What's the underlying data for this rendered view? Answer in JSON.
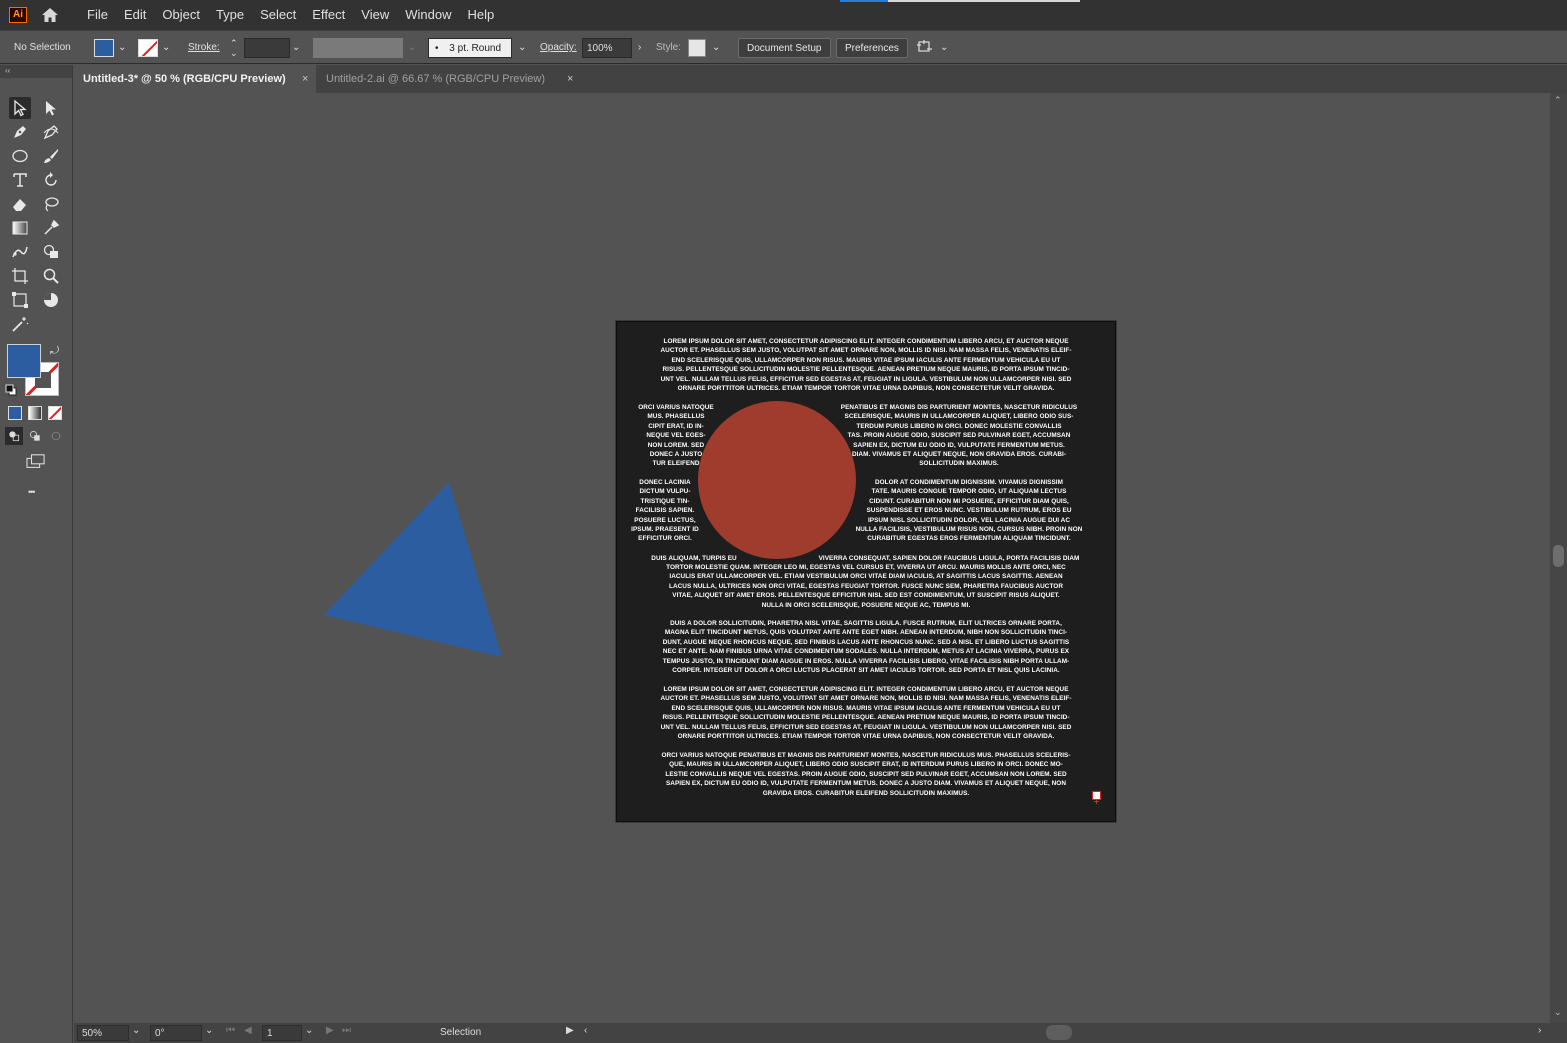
{
  "app": {
    "logo": "Ai"
  },
  "menu": [
    "File",
    "Edit",
    "Object",
    "Type",
    "Select",
    "Effect",
    "View",
    "Window",
    "Help"
  ],
  "control_bar": {
    "selection_status": "No Selection",
    "stroke_label": "Stroke:",
    "brush_value": "3 pt. Round",
    "brush_bullet": "•",
    "opacity_label": "Opacity:",
    "opacity_value": "100%",
    "style_label": "Style:",
    "document_setup": "Document Setup",
    "preferences": "Preferences"
  },
  "tabs": [
    {
      "label": "Untitled-3* @ 50 % (RGB/CPU Preview)",
      "close": "×"
    },
    {
      "label": "Untitled-2.ai @ 66.67 % (RGB/CPU Preview)",
      "close": "×"
    }
  ],
  "toolbar": {
    "collapse": "‹‹",
    "more": "•••"
  },
  "colors": {
    "fill": "#2d5da1",
    "circle": "#a03c2e",
    "triangle": "#2d5da1",
    "artboard": "#1e1e1e",
    "ui_bg": "#535353"
  },
  "artboard_text": {
    "p1": "LOREM IPSUM DOLOR SIT AMET, CONSECTETUR ADIPISCING ELIT. INTEGER CONDIMENTUM LIBERO ARCU, ET AUCTOR NEQUE\nAUCTOR ET. PHASELLUS SEM JUSTO, VOLUTPAT SIT AMET ORNARE NON, MOLLIS ID NISI. NAM MASSA FELIS, VENENATIS ELEIF-\nEND SCELERISQUE QUIS, ULLAMCORPER NON RISUS. MAURIS VITAE IPSUM IACULIS ANTE FERMENTUM VEHICULA EU UT\nRISUS. PELLENTESQUE SOLLICITUDIN MOLESTIE PELLENTESQUE. AENEAN PRETIUM NEQUE MAURIS, ID PORTA IPSUM TINCID-\nUNT VEL. NULLAM TELLUS FELIS, EFFICITUR SED EGESTAS AT, FEUGIAT IN LIGULA. VESTIBULUM NON ULLAMCORPER NISI. SED\nORNARE PORTTITOR ULTRICES. ETIAM TEMPOR TORTOR VITAE URNA DAPIBUS, NON CONSECTETUR VELIT GRAVIDA.",
    "p2_left": "ORCI VARIUS NATOQUE\nMUS. PHASELLUS\nCIPIT ERAT, ID IN-\nNEQUE VEL EGES-\nNON LOREM. SED\nDONEC A JUSTO\nTUR ELEIFEND",
    "p2_right": "PENATIBUS ET MAGNIS DIS PARTURIENT MONTES, NASCETUR RIDICULUS\nSCELERISQUE, MAURIS IN ULLAMCORPER ALIQUET, LIBERO ODIO SUS-\nTERDUM PURUS LIBERO IN ORCI. DONEC MOLESTIE CONVALLIS\nTAS. PROIN AUGUE ODIO, SUSCIPIT SED PULVINAR EGET, ACCUMSAN\nSAPIEN EX, DICTUM EU ODIO ID, VULPUTATE FERMENTUM METUS.\nDIAM. VIVAMUS ET ALIQUET NEQUE, NON GRAVIDA EROS. CURABI-\nSOLLICITUDIN MAXIMUS.",
    "p3_left": "DONEC LACINIA\nDICTUM VULPU-\nTRISTIQUE TIN-\nFACILISIS SAPIEN.\nPOSUERE LUCTUS,\nIPSUM. PRAESENT ID\nEFFICITUR ORCI.",
    "p3_right": "DOLOR AT CONDIMENTUM DIGNISSIM. VIVAMUS DIGNISSIM\nTATE. MAURIS CONGUE TEMPOR ODIO, UT ALIQUAM LECTUS\nCIDUNT. CURABITUR NON MI POSUERE, EFFICITUR DIAM QUIS,\nSUSPENDISSE ET EROS NUNC. VESTIBULUM RUTRUM, EROS EU\nIPSUM NISL SOLLICITUDIN DOLOR, VEL LACINIA AUGUE DUI AC\nNULLA FACILISIS, VESTIBULUM RISUS NON, CURSUS NIBH. PROIN NON\nCURABITUR EGESTAS EROS FERMENTUM ALIQUAM TINCIDUNT.",
    "p4_left": "DUIS ALIQUAM, TURPIS EU",
    "p4_right": "VIVERRA CONSEQUAT, SAPIEN DOLOR FAUCIBUS LIGULA, PORTA FACILISIS DIAM",
    "p4_rest": "TORTOR MOLESTIE QUAM. INTEGER LEO MI, EGESTAS VEL CURSUS ET, VIVERRA UT ARCU. MAURIS MOLLIS ANTE ORCI, NEC\nIACULIS ERAT ULLAMCORPER VEL. ETIAM VESTIBULUM ORCI VITAE DIAM IACULIS, AT SAGITTIS LACUS SAGITTIS. AENEAN\nLACUS NULLA, ULTRICES NON ORCI VITAE, EGESTAS FEUGIAT TORTOR. FUSCE NUNC SEM, PHARETRA FAUCIBUS AUCTOR\nVITAE, ALIQUET SIT AMET EROS. PELLENTESQUE EFFICITUR NISL SED EST CONDIMENTUM, UT SUSCIPIT RISUS ALIQUET.\nNULLA IN ORCI SCELERISQUE, POSUERE NEQUE AC, TEMPUS MI.",
    "p5": "DUIS A DOLOR SOLLICITUDIN, PHARETRA NISL VITAE, SAGITTIS LIGULA. FUSCE RUTRUM, ELIT ULTRICES ORNARE PORTA,\nMAGNA ELIT TINCIDUNT METUS, QUIS VOLUTPAT ANTE ANTE EGET NIBH. AENEAN INTERDUM, NIBH NON SOLLICITUDIN TINCI-\nDUNT, AUGUE NEQUE RHONCUS NEQUE, SED FINIBUS LACUS ANTE RHONCUS NUNC. SED A NISL ET LIBERO LUCTUS SAGITTIS\nNEC ET ANTE. NAM FINIBUS URNA VITAE CONDIMENTUM SODALES. NULLA INTERDUM, METUS AT LACINIA VIVERRA, PURUS EX\nTEMPUS JUSTO, IN TINCIDUNT DIAM AUGUE IN EROS. NULLA VIVERRA FACILISIS LIBERO, VITAE FACILISIS NIBH PORTA ULLAM-\nCORPER. INTEGER UT DOLOR A ORCI LUCTUS PLACERAT SIT AMET IACULIS TORTOR. SED PORTA ET NISL QUIS LACINIA.",
    "p6": "LOREM IPSUM DOLOR SIT AMET, CONSECTETUR ADIPISCING ELIT. INTEGER CONDIMENTUM LIBERO ARCU, ET AUCTOR NEQUE\nAUCTOR ET. PHASELLUS SEM JUSTO, VOLUTPAT SIT AMET ORNARE NON, MOLLIS ID NISI. NAM MASSA FELIS, VENENATIS ELEIF-\nEND SCELERISQUE QUIS, ULLAMCORPER NON RISUS. MAURIS VITAE IPSUM IACULIS ANTE FERMENTUM VEHICULA EU UT\nRISUS. PELLENTESQUE SOLLICITUDIN MOLESTIE PELLENTESQUE. AENEAN PRETIUM NEQUE MAURIS, ID PORTA IPSUM TINCID-\nUNT VEL. NULLAM TELLUS FELIS, EFFICITUR SED EGESTAS AT, FEUGIAT IN LIGULA. VESTIBULUM NON ULLAMCORPER NISI. SED\nORNARE PORTTITOR ULTRICES. ETIAM TEMPOR TORTOR VITAE URNA DAPIBUS, NON CONSECTETUR VELIT GRAVIDA.",
    "p7": "ORCI VARIUS NATOQUE PENATIBUS ET MAGNIS DIS PARTURIENT MONTES, NASCETUR RIDICULUS MUS. PHASELLUS SCELERIS-\nQUE, MAURIS IN ULLAMCORPER ALIQUET, LIBERO ODIO SUSCIPIT ERAT, ID INTERDUM PURUS LIBERO IN ORCI. DONEC MO-\nLESTIE CONVALLIS NEQUE VEL EGESTAS. PROIN AUGUE ODIO, SUSCIPIT SED PULVINAR EGET, ACCUMSAN NON LOREM. SED\nSAPIEN EX, DICTUM EU ODIO ID, VULPUTATE FERMENTUM METUS. DONEC A JUSTO DIAM. VIVAMUS ET ALIQUET NEQUE, NON\nGRAVIDA EROS. CURABITUR ELEIFEND SOLLICITUDIN MAXIMUS."
  },
  "status_bar": {
    "zoom": "50%",
    "rotation": "0°",
    "artboard_number": "1",
    "tool_name": "Selection"
  }
}
